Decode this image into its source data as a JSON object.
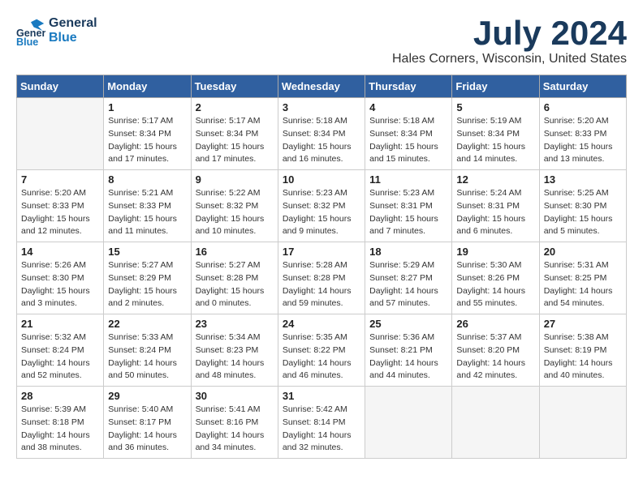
{
  "header": {
    "logo_line1": "General",
    "logo_line2": "Blue",
    "month_title": "July 2024",
    "location": "Hales Corners, Wisconsin, United States"
  },
  "weekdays": [
    "Sunday",
    "Monday",
    "Tuesday",
    "Wednesday",
    "Thursday",
    "Friday",
    "Saturday"
  ],
  "weeks": [
    [
      {
        "day": "",
        "empty": true
      },
      {
        "day": "1",
        "sunrise": "5:17 AM",
        "sunset": "8:34 PM",
        "daylight": "15 hours and 17 minutes."
      },
      {
        "day": "2",
        "sunrise": "5:17 AM",
        "sunset": "8:34 PM",
        "daylight": "15 hours and 17 minutes."
      },
      {
        "day": "3",
        "sunrise": "5:18 AM",
        "sunset": "8:34 PM",
        "daylight": "15 hours and 16 minutes."
      },
      {
        "day": "4",
        "sunrise": "5:18 AM",
        "sunset": "8:34 PM",
        "daylight": "15 hours and 15 minutes."
      },
      {
        "day": "5",
        "sunrise": "5:19 AM",
        "sunset": "8:34 PM",
        "daylight": "15 hours and 14 minutes."
      },
      {
        "day": "6",
        "sunrise": "5:20 AM",
        "sunset": "8:33 PM",
        "daylight": "15 hours and 13 minutes."
      }
    ],
    [
      {
        "day": "7",
        "sunrise": "5:20 AM",
        "sunset": "8:33 PM",
        "daylight": "15 hours and 12 minutes."
      },
      {
        "day": "8",
        "sunrise": "5:21 AM",
        "sunset": "8:33 PM",
        "daylight": "15 hours and 11 minutes."
      },
      {
        "day": "9",
        "sunrise": "5:22 AM",
        "sunset": "8:32 PM",
        "daylight": "15 hours and 10 minutes."
      },
      {
        "day": "10",
        "sunrise": "5:23 AM",
        "sunset": "8:32 PM",
        "daylight": "15 hours and 9 minutes."
      },
      {
        "day": "11",
        "sunrise": "5:23 AM",
        "sunset": "8:31 PM",
        "daylight": "15 hours and 7 minutes."
      },
      {
        "day": "12",
        "sunrise": "5:24 AM",
        "sunset": "8:31 PM",
        "daylight": "15 hours and 6 minutes."
      },
      {
        "day": "13",
        "sunrise": "5:25 AM",
        "sunset": "8:30 PM",
        "daylight": "15 hours and 5 minutes."
      }
    ],
    [
      {
        "day": "14",
        "sunrise": "5:26 AM",
        "sunset": "8:30 PM",
        "daylight": "15 hours and 3 minutes."
      },
      {
        "day": "15",
        "sunrise": "5:27 AM",
        "sunset": "8:29 PM",
        "daylight": "15 hours and 2 minutes."
      },
      {
        "day": "16",
        "sunrise": "5:27 AM",
        "sunset": "8:28 PM",
        "daylight": "15 hours and 0 minutes."
      },
      {
        "day": "17",
        "sunrise": "5:28 AM",
        "sunset": "8:28 PM",
        "daylight": "14 hours and 59 minutes."
      },
      {
        "day": "18",
        "sunrise": "5:29 AM",
        "sunset": "8:27 PM",
        "daylight": "14 hours and 57 minutes."
      },
      {
        "day": "19",
        "sunrise": "5:30 AM",
        "sunset": "8:26 PM",
        "daylight": "14 hours and 55 minutes."
      },
      {
        "day": "20",
        "sunrise": "5:31 AM",
        "sunset": "8:25 PM",
        "daylight": "14 hours and 54 minutes."
      }
    ],
    [
      {
        "day": "21",
        "sunrise": "5:32 AM",
        "sunset": "8:24 PM",
        "daylight": "14 hours and 52 minutes."
      },
      {
        "day": "22",
        "sunrise": "5:33 AM",
        "sunset": "8:24 PM",
        "daylight": "14 hours and 50 minutes."
      },
      {
        "day": "23",
        "sunrise": "5:34 AM",
        "sunset": "8:23 PM",
        "daylight": "14 hours and 48 minutes."
      },
      {
        "day": "24",
        "sunrise": "5:35 AM",
        "sunset": "8:22 PM",
        "daylight": "14 hours and 46 minutes."
      },
      {
        "day": "25",
        "sunrise": "5:36 AM",
        "sunset": "8:21 PM",
        "daylight": "14 hours and 44 minutes."
      },
      {
        "day": "26",
        "sunrise": "5:37 AM",
        "sunset": "8:20 PM",
        "daylight": "14 hours and 42 minutes."
      },
      {
        "day": "27",
        "sunrise": "5:38 AM",
        "sunset": "8:19 PM",
        "daylight": "14 hours and 40 minutes."
      }
    ],
    [
      {
        "day": "28",
        "sunrise": "5:39 AM",
        "sunset": "8:18 PM",
        "daylight": "14 hours and 38 minutes."
      },
      {
        "day": "29",
        "sunrise": "5:40 AM",
        "sunset": "8:17 PM",
        "daylight": "14 hours and 36 minutes."
      },
      {
        "day": "30",
        "sunrise": "5:41 AM",
        "sunset": "8:16 PM",
        "daylight": "14 hours and 34 minutes."
      },
      {
        "day": "31",
        "sunrise": "5:42 AM",
        "sunset": "8:14 PM",
        "daylight": "14 hours and 32 minutes."
      },
      {
        "day": "",
        "empty": true
      },
      {
        "day": "",
        "empty": true
      },
      {
        "day": "",
        "empty": true
      }
    ]
  ],
  "labels": {
    "sunrise": "Sunrise:",
    "sunset": "Sunset:",
    "daylight": "Daylight:"
  }
}
